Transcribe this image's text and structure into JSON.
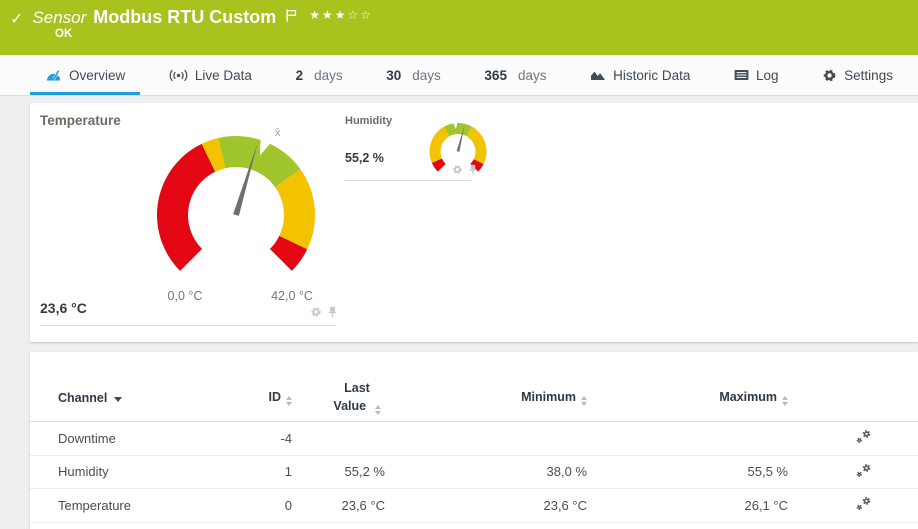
{
  "header": {
    "kind_label": "Sensor",
    "title": "Modbus RTU Custom",
    "status_text": "OK",
    "priority": {
      "filled": 3,
      "total": 5
    },
    "bg_color": "#a9c21e"
  },
  "tabs": [
    {
      "label": "Overview",
      "icon": "gauge-icon",
      "active": true
    },
    {
      "label": "Live Data",
      "icon": "broadcast-icon",
      "active": false
    },
    {
      "prefix": "2",
      "label": "days",
      "active": false
    },
    {
      "prefix": "30",
      "label": "days",
      "active": false
    },
    {
      "prefix": "365",
      "label": "days",
      "active": false
    },
    {
      "label": "Historic Data",
      "icon": "histogram-icon",
      "active": false
    },
    {
      "label": "Log",
      "icon": "log-icon",
      "active": false
    },
    {
      "label": "Settings",
      "icon": "gear-icon",
      "active": false
    }
  ],
  "colors": {
    "header_bg": "#a9c21e",
    "accent_blue": "#1b9ed9",
    "gauge_red": "#e30613",
    "gauge_yellow": "#f3c200",
    "gauge_green": "#a0c52d",
    "page_bg": "#efefef"
  },
  "icons": {
    "status-check": "✓",
    "flag": "outline-flag",
    "star-filled": "★",
    "star-empty": "☆",
    "overview": "gauge",
    "live-data": "broadcast-waves",
    "historic-data": "area-chart",
    "log": "lined-card",
    "settings": "gear",
    "gauge-settings": "gear",
    "gauge-pin": "pushpin",
    "channel-settings": "double-gear",
    "sort": "up-down-arrows",
    "sort-active": "down-caret",
    "average-marker": "x-bar"
  },
  "gauges": [
    {
      "name": "Temperature",
      "value": 23.6,
      "value_label": "23,6 °C",
      "min": 0,
      "max": 42,
      "min_label": "0,0 °C",
      "max_label": "42,0 °C",
      "average": 24.4,
      "segments": [
        {
          "from": 0,
          "to": 17,
          "color": "#e30613"
        },
        {
          "from": 17,
          "to": 19,
          "color": "#f3c200"
        },
        {
          "from": 19,
          "to": 29.5,
          "color": "#a0c52d"
        },
        {
          "from": 29.5,
          "to": 39,
          "color": "#f3c200"
        },
        {
          "from": 39,
          "to": 42,
          "color": "#e30613"
        }
      ]
    },
    {
      "name": "Humidity",
      "value": 55.2,
      "value_label": "55,2 %",
      "min": 0,
      "max": 100,
      "average": 48,
      "segments": [
        {
          "from": 0,
          "to": 8,
          "color": "#e30613"
        },
        {
          "from": 8,
          "to": 39,
          "color": "#f3c200"
        },
        {
          "from": 39,
          "to": 61,
          "color": "#a0c52d"
        },
        {
          "from": 61,
          "to": 93,
          "color": "#f3c200"
        },
        {
          "from": 93,
          "to": 100,
          "color": "#e30613"
        }
      ]
    }
  ],
  "channel_table": {
    "columns": [
      "Channel",
      "ID",
      "Last Value",
      "Minimum",
      "Maximum"
    ],
    "rows": [
      {
        "channel": "Downtime",
        "id": "-4",
        "last_value": "",
        "minimum": "",
        "maximum": ""
      },
      {
        "channel": "Humidity",
        "id": "1",
        "last_value": "55,2 %",
        "minimum": "38,0 %",
        "maximum": "55,5 %"
      },
      {
        "channel": "Temperature",
        "id": "0",
        "last_value": "23,6 °C",
        "minimum": "23,6 °C",
        "maximum": "26,1 °C"
      }
    ]
  }
}
